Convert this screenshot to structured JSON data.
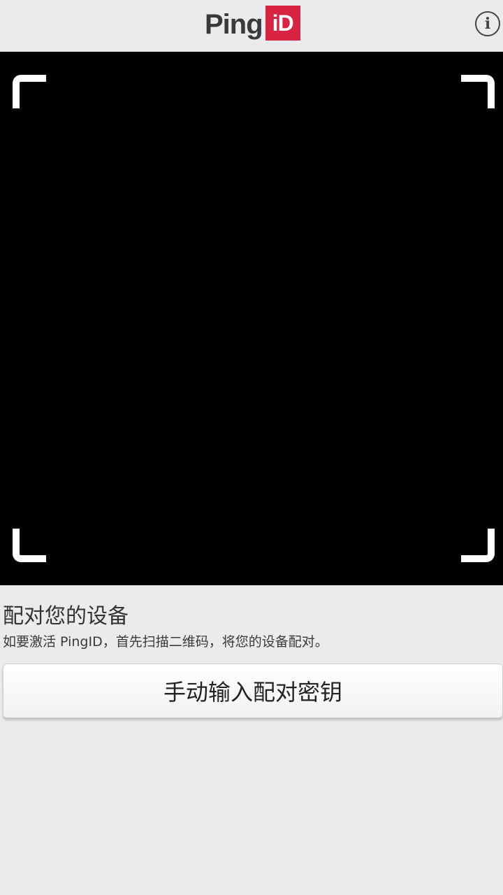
{
  "header": {
    "logo_text": "Ping",
    "logo_badge": "iD",
    "info_icon": "info-icon",
    "info_glyph": "i",
    "brand_color": "#d92342"
  },
  "scanner": {
    "background": "#000000",
    "frame_color": "#ffffff"
  },
  "pairing": {
    "title": "配对您的设备",
    "description": "如要激活 PingID，首先扫描二维码，将您的设备配对。",
    "manual_button_label": "手动输入配对密钥"
  }
}
